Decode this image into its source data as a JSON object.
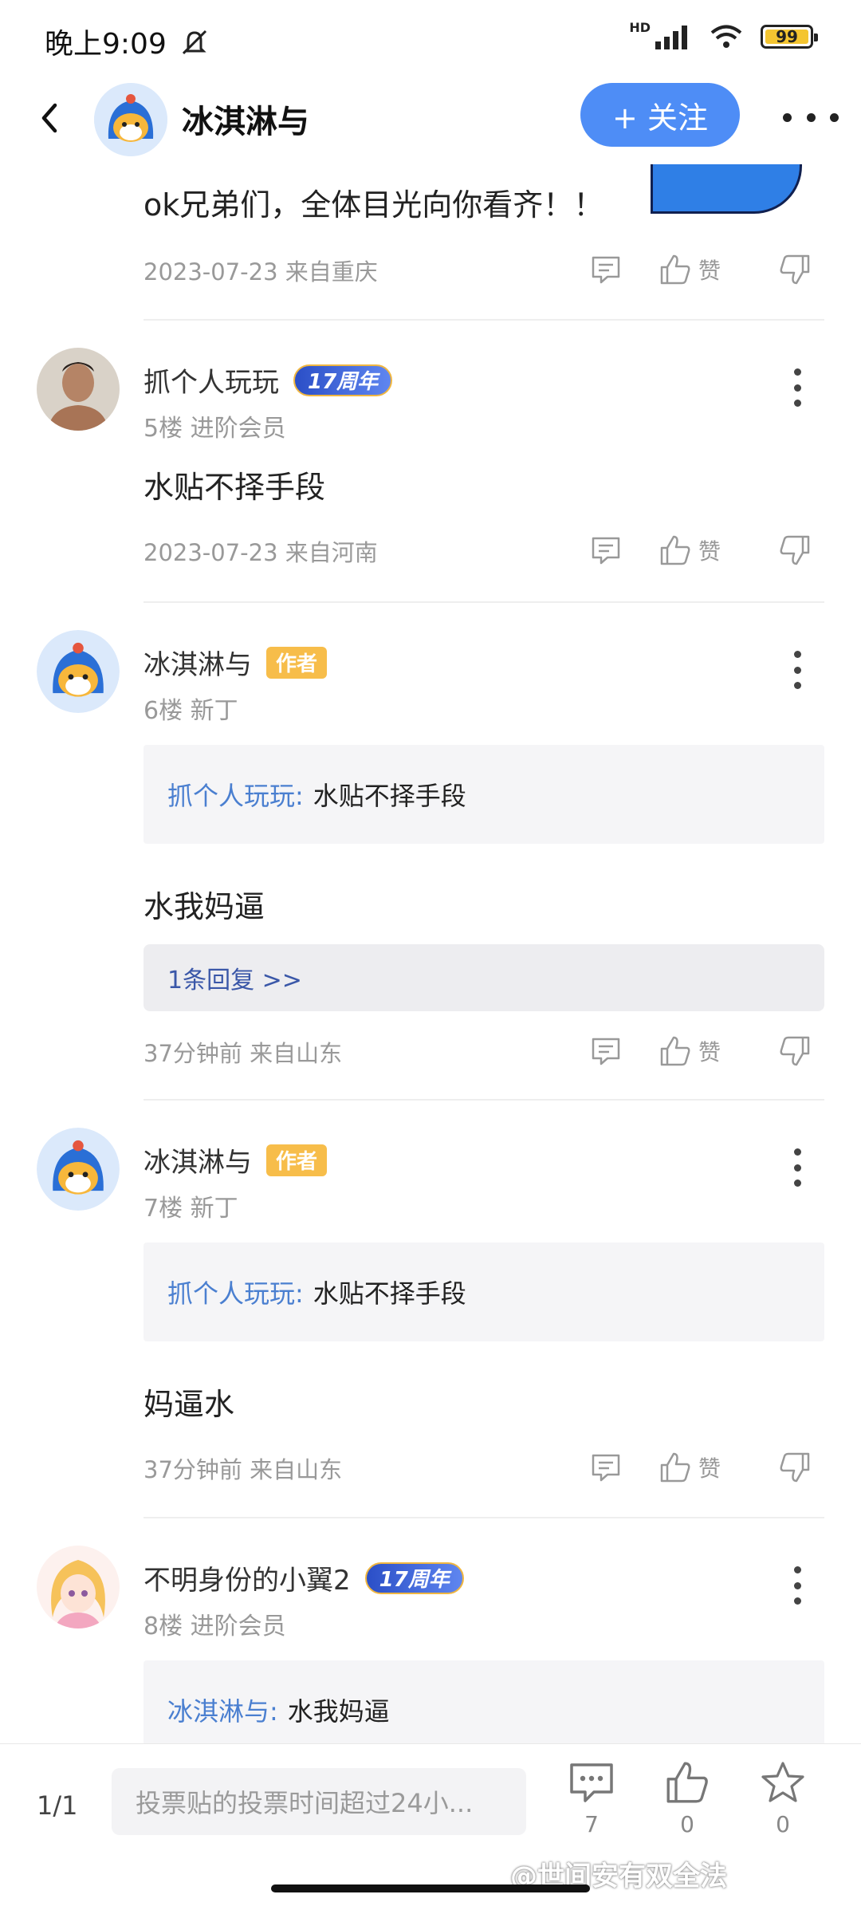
{
  "status_bar": {
    "time": "晚上9:09",
    "network": "HD",
    "battery": "99"
  },
  "header": {
    "title": "冰淇淋与",
    "follow_label": "+ 关注"
  },
  "posts": [
    {
      "text": "ok兄弟们，全体目光向你看齐！！",
      "date": "2023-07-23 来自重庆",
      "like_label": "赞"
    },
    {
      "username": "抓个人玩玩",
      "badge": "17周年",
      "floor": "5楼 进阶会员",
      "text": "水贴不择手段",
      "date": "2023-07-23 来自河南",
      "like_label": "赞"
    },
    {
      "username": "冰淇淋与",
      "badge": "作者",
      "floor": "6楼 新丁",
      "quote_name": "抓个人玩玩:",
      "quote_text": "水贴不择手段",
      "text": "水我妈逼",
      "replies": "1条回复 >>",
      "date": "37分钟前 来自山东",
      "like_label": "赞"
    },
    {
      "username": "冰淇淋与",
      "badge": "作者",
      "floor": "7楼 新丁",
      "quote_name": "抓个人玩玩:",
      "quote_text": "水贴不择手段",
      "text": "妈逼水",
      "date": "37分钟前 来自山东",
      "like_label": "赞"
    },
    {
      "username": "不明身份的小翼2",
      "badge": "17周年",
      "floor": "8楼 进阶会员",
      "quote_name": "冰淇淋与:",
      "quote_text": "水我妈逼"
    }
  ],
  "bottom_bar": {
    "page": "1/1",
    "input_placeholder": "投票贴的投票时间超过24小...",
    "comments_count": "7",
    "likes_count": "0",
    "favorites_count": "0",
    "watermark": "@世间安有双全法"
  },
  "colors": {
    "accent": "#4e8df6",
    "author_badge": "#f7bd4a",
    "quote_name": "#4a7fd0"
  }
}
